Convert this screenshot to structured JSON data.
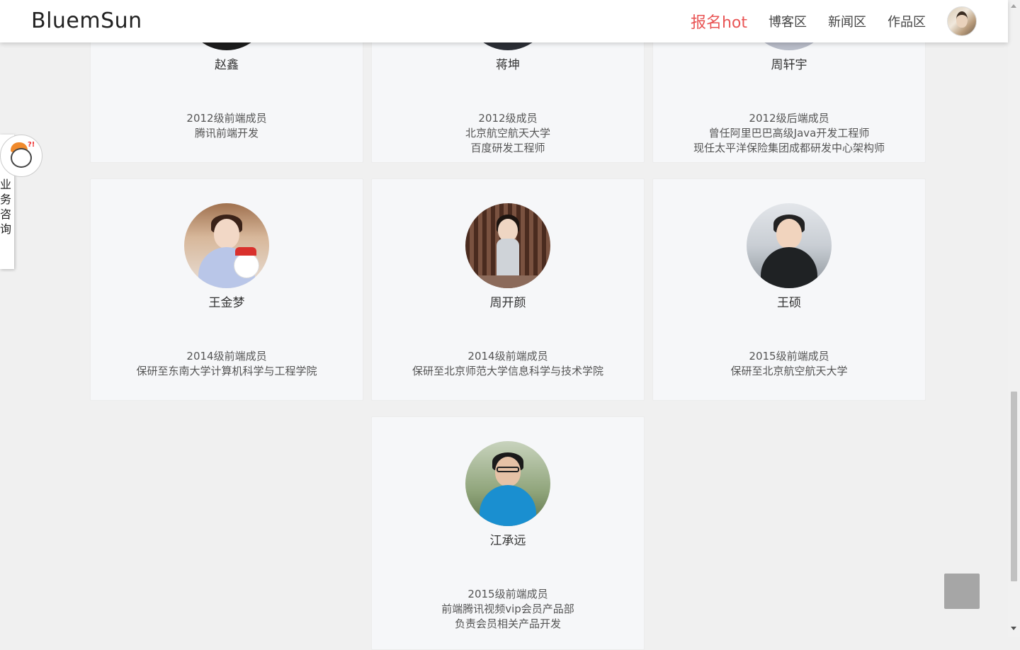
{
  "header": {
    "brand": "BluemSun",
    "nav": [
      {
        "label": "报名hot"
      },
      {
        "label": "博客区"
      },
      {
        "label": "新闻区"
      },
      {
        "label": "作品区"
      }
    ]
  },
  "sidebar": {
    "consult_chars": [
      "业",
      "务",
      "咨",
      "询"
    ]
  },
  "members": [
    {
      "name": "赵鑫",
      "lines": [
        "2012级前端成员",
        "腾讯前端开发"
      ]
    },
    {
      "name": "蒋坤",
      "lines": [
        "2012级成员",
        "北京航空航天大学",
        "百度研发工程师"
      ]
    },
    {
      "name": "周轩宇",
      "lines": [
        "2012级后端成员",
        "曾任阿里巴巴高级Java开发工程师",
        "现任太平洋保险集团成都研发中心架构师"
      ]
    },
    {
      "name": "王金梦",
      "lines": [
        "2014级前端成员",
        "保研至东南大学计算机科学与工程学院"
      ]
    },
    {
      "name": "周开颜",
      "lines": [
        "2014级前端成员",
        "保研至北京师范大学信息科学与技术学院"
      ]
    },
    {
      "name": "王硕",
      "lines": [
        "2015级前端成员",
        "保研至北京航空航天大学"
      ]
    },
    {
      "name": "江承远",
      "lines": [
        "2015级前端成员",
        "前端腾讯视频vip会员产品部",
        "负责会员相关产品开发"
      ]
    }
  ]
}
